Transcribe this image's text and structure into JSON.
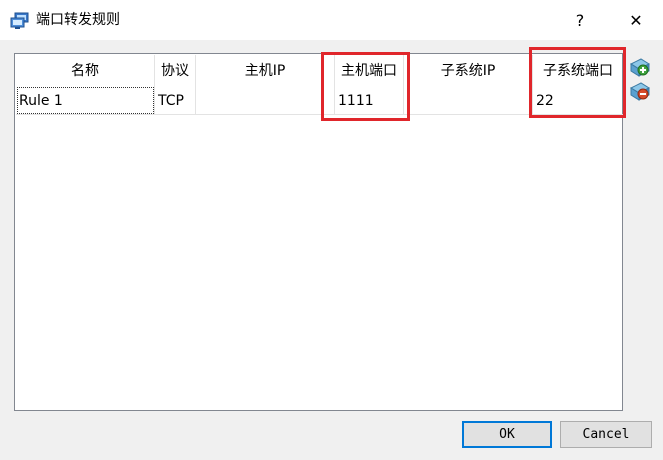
{
  "window": {
    "title": "端口转发规则",
    "help_label": "?",
    "close_label": "✕"
  },
  "table": {
    "columns": [
      "名称",
      "协议",
      "主机IP",
      "主机端口",
      "子系统IP",
      "子系统端口"
    ],
    "rows": [
      [
        "Rule 1",
        "TCP",
        "",
        "1111",
        "",
        "22"
      ]
    ]
  },
  "side_buttons": {
    "add_icon": "add-rule-icon",
    "remove_icon": "remove-rule-icon"
  },
  "buttons": {
    "ok": "OK",
    "cancel": "Cancel"
  },
  "colors": {
    "highlight": "#e0262b",
    "focus_border": "#0078d7"
  }
}
